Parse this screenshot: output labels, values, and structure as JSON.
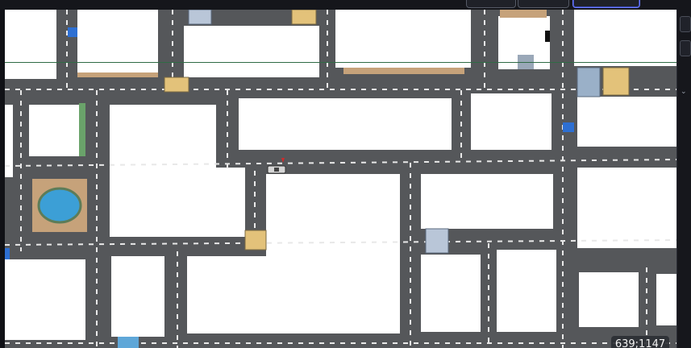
{
  "map": {
    "coordinate_readout": "639;1147",
    "colors": {
      "road": "#55575a",
      "lane_mark": "#e8e8e8",
      "block": "#ffffff",
      "water": "#3c9fd6",
      "guide": "#2f6b45",
      "panel": "#16171c"
    },
    "entities": {
      "vehicle_icon": "car-icon",
      "marker_icon": "location-pin-icon",
      "building_icon": "building-icon",
      "sign_icon": "road-sign-icon",
      "pond_icon": "pond-icon"
    }
  }
}
